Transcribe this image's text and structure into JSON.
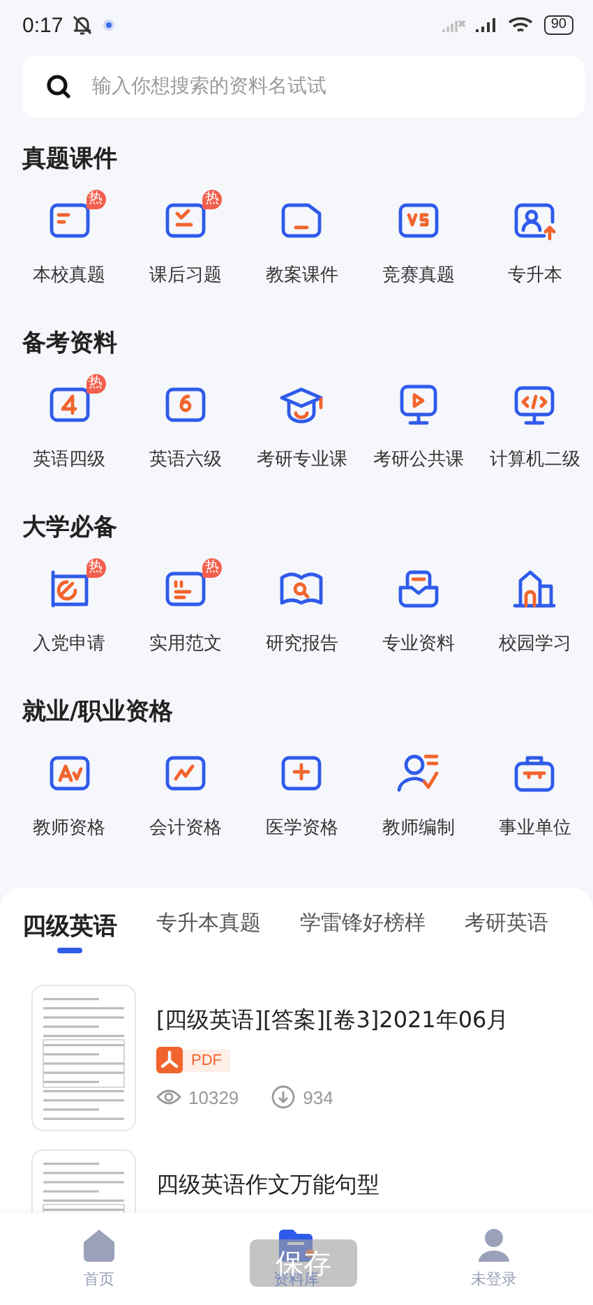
{
  "status_bar": {
    "time": "0:17",
    "battery": "90"
  },
  "search": {
    "placeholder": "输入你想搜索的资料名试试"
  },
  "sections": [
    {
      "title": "真题课件",
      "items": [
        {
          "label": "本校真题",
          "badge": "热"
        },
        {
          "label": "课后习题",
          "badge": "热"
        },
        {
          "label": "教案课件"
        },
        {
          "label": "竞赛真题"
        },
        {
          "label": "专升本"
        }
      ]
    },
    {
      "title": "备考资料",
      "items": [
        {
          "label": "英语四级",
          "badge": "热"
        },
        {
          "label": "英语六级"
        },
        {
          "label": "考研专业课"
        },
        {
          "label": "考研公共课"
        },
        {
          "label": "计算机二级"
        }
      ]
    },
    {
      "title": "大学必备",
      "items": [
        {
          "label": "入党申请",
          "badge": "热"
        },
        {
          "label": "实用范文",
          "badge": "热"
        },
        {
          "label": "研究报告"
        },
        {
          "label": "专业资料"
        },
        {
          "label": "校园学习"
        }
      ]
    },
    {
      "title": "就业/职业资格",
      "items": [
        {
          "label": "教师资格"
        },
        {
          "label": "会计资格"
        },
        {
          "label": "医学资格"
        },
        {
          "label": "教师编制"
        },
        {
          "label": "事业单位"
        }
      ]
    }
  ],
  "tabs": [
    {
      "label": "四级英语",
      "selected": true
    },
    {
      "label": "专升本真题",
      "selected": false
    },
    {
      "label": "学雷锋好榜样",
      "selected": false
    },
    {
      "label": "考研英语",
      "selected": false
    }
  ],
  "documents": [
    {
      "title": "[四级英语][答案][卷3]2021年06月",
      "file_type": "PDF",
      "views": "10329",
      "downloads": "934"
    },
    {
      "title": "四级英语作文万能句型"
    }
  ],
  "nav": [
    {
      "label": "首页",
      "selected": false
    },
    {
      "label": "资料库",
      "selected": true
    },
    {
      "label": "未登录",
      "selected": false
    }
  ],
  "toast": "保存"
}
